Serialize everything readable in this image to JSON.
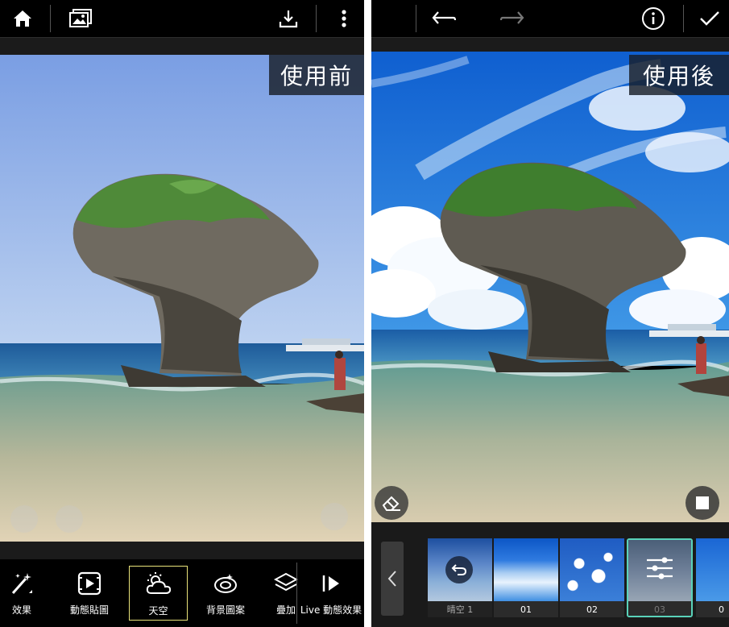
{
  "left": {
    "label": "使用前",
    "tools": [
      {
        "label": "效果",
        "icon": "magic-wand-icon"
      },
      {
        "label": "動態貼圖",
        "icon": "animated-sticker-icon"
      },
      {
        "label": "天空",
        "icon": "cloud-sun-icon"
      },
      {
        "label": "背景圖案",
        "icon": "pattern-icon"
      },
      {
        "label": "疊加",
        "icon": "layers-icon"
      },
      {
        "label": "Live 動態效果",
        "icon": "live-play-icon"
      }
    ]
  },
  "right": {
    "label": "使用後",
    "skies": [
      {
        "label": "晴空 1"
      },
      {
        "label": "01"
      },
      {
        "label": "02"
      },
      {
        "label": "03"
      },
      {
        "label": "0"
      }
    ]
  },
  "colors": {
    "selected_tool_border": "#e9e37a",
    "selected_thumb_border": "#59d2b9",
    "background": "#000000"
  }
}
